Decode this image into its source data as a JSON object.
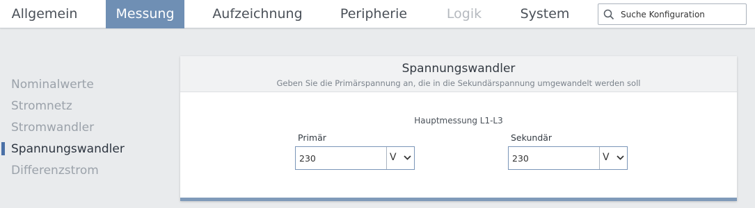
{
  "tabs": [
    {
      "label": "Allgemein",
      "state": "normal"
    },
    {
      "label": "Messung",
      "state": "active"
    },
    {
      "label": "Aufzeichnung",
      "state": "normal"
    },
    {
      "label": "Peripherie",
      "state": "normal"
    },
    {
      "label": "Logik",
      "state": "disabled"
    },
    {
      "label": "System",
      "state": "normal"
    }
  ],
  "search": {
    "placeholder": "Suche Konfiguration",
    "icon": "search-icon"
  },
  "sidebar": {
    "items": [
      {
        "label": "Nominalwerte",
        "active": false
      },
      {
        "label": "Stromnetz",
        "active": false
      },
      {
        "label": "Stromwandler",
        "active": false
      },
      {
        "label": "Spannungswandler",
        "active": true
      },
      {
        "label": "Differenzstrom",
        "active": false
      }
    ]
  },
  "card": {
    "title": "Spannungswandler",
    "subtitle": "Geben Sie die Primärspannung an, die in die Sekundärspannung umgewandelt werden soll",
    "group_label": "Hauptmessung L1-L3",
    "primary": {
      "label": "Primär",
      "value": "230",
      "unit": "V"
    },
    "secondary": {
      "label": "Sekundär",
      "value": "230",
      "unit": "V"
    }
  },
  "colors": {
    "accent": "#6f8fb4",
    "sidebar_marker": "#4a70a6",
    "background": "#e9ebed"
  }
}
